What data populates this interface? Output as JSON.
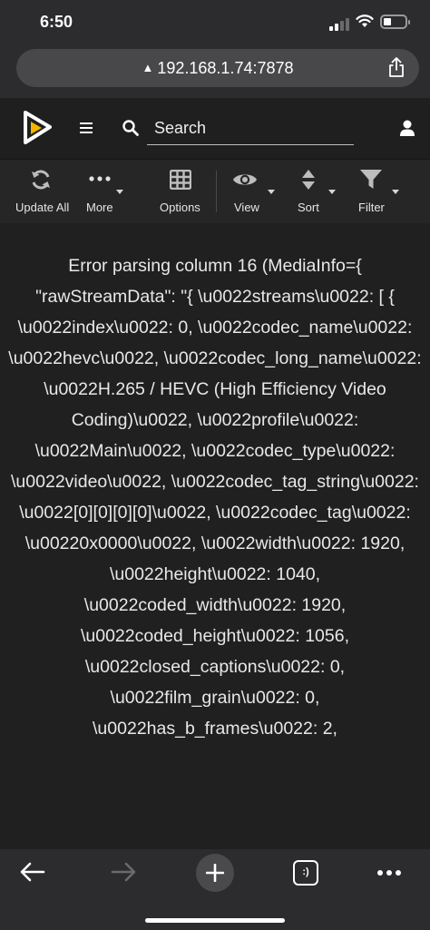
{
  "status_bar": {
    "time": "6:50"
  },
  "browser": {
    "url": "192.168.1.74:7878",
    "warning_icon": "warning-triangle-icon",
    "share_icon": "share-icon"
  },
  "header": {
    "logo": "radarr-play-logo",
    "menu_icon": "hamburger-icon",
    "search_placeholder": "Search",
    "user_icon": "user-icon",
    "accent_color": "#f5b400"
  },
  "toolbar": {
    "update_all": "Update All",
    "more": "More",
    "options": "Options",
    "view": "View",
    "sort": "Sort",
    "filter": "Filter"
  },
  "error_message": "Error parsing column 16 (MediaInfo={ \"rawStreamData\": \"{ \\u0022streams\\u0022: [ { \\u0022index\\u0022: 0, \\u0022codec_name\\u0022: \\u0022hevc\\u0022, \\u0022codec_long_name\\u0022: \\u0022H.265 / HEVC (High Efficiency Video Coding)\\u0022, \\u0022profile\\u0022: \\u0022Main\\u0022, \\u0022codec_type\\u0022: \\u0022video\\u0022, \\u0022codec_tag_string\\u0022: \\u0022[0][0][0][0]\\u0022, \\u0022codec_tag\\u0022: \\u00220x0000\\u0022, \\u0022width\\u0022: 1920, \\u0022height\\u0022: 1040, \\u0022coded_width\\u0022: 1920, \\u0022coded_height\\u0022: 1056, \\u0022closed_captions\\u0022: 0, \\u0022film_grain\\u0022: 0, \\u0022has_b_frames\\u0022: 2,",
  "bottom_bar": {
    "back_icon": "back-arrow-icon",
    "forward_icon": "forward-arrow-icon",
    "new_tab_icon": "plus-icon",
    "tabs_icon": "tabs-icon",
    "tabs_label": ":)",
    "more_icon": "more-dots-icon"
  }
}
